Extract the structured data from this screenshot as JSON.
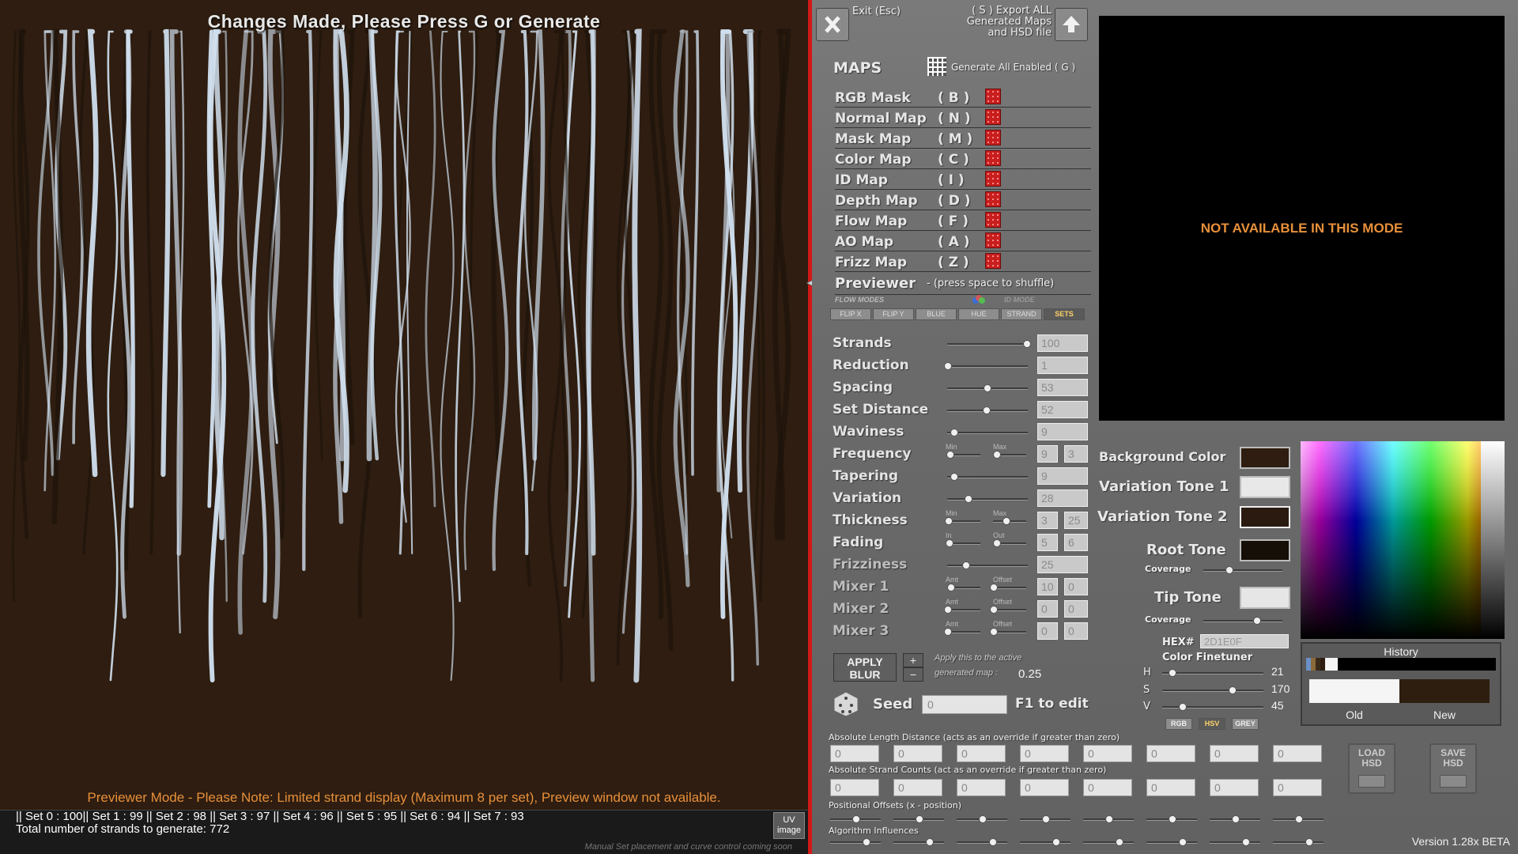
{
  "preview": {
    "banner": "Changes Made, Please Press G or Generate",
    "note": "Previewer Mode - Please Note: Limited strand display (Maximum 8 per set), Preview window not available.",
    "sets_line": "|| Set 0 : 100|| Set 1 : 99 || Set 2 : 98 || Set 3 : 97 || Set 4 : 96 || Set 5 : 95 || Set 6 : 94 || Set 7 : 93",
    "total_line": "Total number of strands to generate: 772",
    "coming_soon": "Manual Set placement and curve control coming soon",
    "uv_button": "UV image",
    "background_color": "#2e1d10",
    "strand_color": "#d1e0ef"
  },
  "header": {
    "exit_label": "Exit (Esc)",
    "export_label_1": "( S ) Export ALL",
    "export_label_2": "Generated Maps",
    "export_label_3": "and HSD file"
  },
  "maps": {
    "title": "MAPS",
    "generate_all": "Generate All Enabled ( G )",
    "items": [
      {
        "name": "RGB Mask",
        "key": "( B )"
      },
      {
        "name": "Normal Map",
        "key": "( N )"
      },
      {
        "name": "Mask Map",
        "key": "( M )"
      },
      {
        "name": "Color Map",
        "key": "( C )"
      },
      {
        "name": "ID Map",
        "key": "( I )"
      },
      {
        "name": "Depth Map",
        "key": "( D )"
      },
      {
        "name": "Flow Map",
        "key": "( F )"
      },
      {
        "name": "AO Map",
        "key": "( A )"
      },
      {
        "name": "Frizz Map",
        "key": "( Z )"
      }
    ],
    "previewer": "Previewer",
    "previewer_hint": "- (press space to shuffle)",
    "flow_modes": "FLOW MODES",
    "id_mode": "ID MODE",
    "mode_buttons": [
      "FLIP X",
      "FLIP Y",
      "BLUE",
      "HUE",
      "STRAND",
      "SETS"
    ]
  },
  "params": {
    "strands": {
      "label": "Strands",
      "value": "100"
    },
    "reduction": {
      "label": "Reduction",
      "value": "1"
    },
    "spacing": {
      "label": "Spacing",
      "value": "53"
    },
    "set_distance": {
      "label": "Set Distance",
      "value": "52"
    },
    "waviness": {
      "label": "Waviness",
      "value": "9"
    },
    "frequency": {
      "label": "Frequency",
      "value_a": "9",
      "value_b": "3",
      "sub_a": "Min",
      "sub_b": "Max"
    },
    "tapering": {
      "label": "Tapering",
      "value": "9"
    },
    "variation": {
      "label": "Variation",
      "value": "28"
    },
    "thickness": {
      "label": "Thickness",
      "value_a": "3",
      "value_b": "25",
      "sub_a": "Min",
      "sub_b": "Max"
    },
    "fading": {
      "label": "Fading",
      "value_a": "5",
      "value_b": "6",
      "sub_a": "In",
      "sub_b": "Out"
    },
    "frizziness": {
      "label": "Frizziness",
      "value": "25"
    },
    "mixer1": {
      "label": "Mixer 1",
      "value_a": "10",
      "value_b": "0",
      "sub_a": "Amt",
      "sub_b": "Offset"
    },
    "mixer2": {
      "label": "Mixer 2",
      "value_a": "0",
      "value_b": "0",
      "sub_a": "Amt",
      "sub_b": "Offset"
    },
    "mixer3": {
      "label": "Mixer 3",
      "value_a": "0",
      "value_b": "0",
      "sub_a": "Amt",
      "sub_b": "Offset"
    }
  },
  "blur": {
    "button_1": "APPLY",
    "button_2": "BLUR",
    "note_1": "Apply this to the active",
    "note_2": "generated map :",
    "value": "0.25",
    "plus": "+",
    "minus": "−"
  },
  "seed": {
    "label": "Seed",
    "value": "0",
    "hint": "F1 to edit"
  },
  "preview_window": {
    "message": "NOT AVAILABLE IN THIS MODE"
  },
  "colors": {
    "background_color": {
      "label": "Background Color",
      "swatch": "#2e1d10"
    },
    "variation_tone_1": {
      "label": "Variation Tone 1",
      "swatch": "#e8e8e8"
    },
    "variation_tone_2": {
      "label": "Variation Tone 2",
      "swatch": "#2a1a10"
    },
    "root_tone": {
      "label": "Root Tone",
      "swatch": "#150f08",
      "coverage": "Coverage"
    },
    "tip_tone": {
      "label": "Tip Tone",
      "swatch": "#e6e6e6",
      "coverage": "Coverage"
    },
    "hex_label": "HEX#",
    "hex_value": "2D1E0F",
    "finetuner": "Color Finetuner",
    "h": {
      "label": "H",
      "value": "21"
    },
    "s": {
      "label": "S",
      "value": "170"
    },
    "v": {
      "label": "V",
      "value": "45"
    },
    "modes": [
      "RGB",
      "HSV",
      "GREY"
    ],
    "history": "History",
    "old": "Old",
    "new": "New",
    "old_color": "#f5f5f5",
    "new_color": "#2d1e0f"
  },
  "absolute": {
    "length_label": "Absolute Length Distance (acts as an override if greater than zero)",
    "length_values": [
      "0",
      "0",
      "0",
      "0",
      "0",
      "0",
      "0",
      "0"
    ],
    "counts_label": "Absolute Strand Counts (act as an override if greater than zero)",
    "counts_values": [
      "0",
      "0",
      "0",
      "0",
      "0",
      "0",
      "0",
      "0"
    ],
    "offsets_label": "Positional Offsets (x - position)",
    "algo_label": "Algorithm Influences"
  },
  "hsd": {
    "load_1": "LOAD",
    "load_2": "HSD",
    "save_1": "SAVE",
    "save_2": "HSD"
  },
  "version": "Version 1.28x BETA"
}
